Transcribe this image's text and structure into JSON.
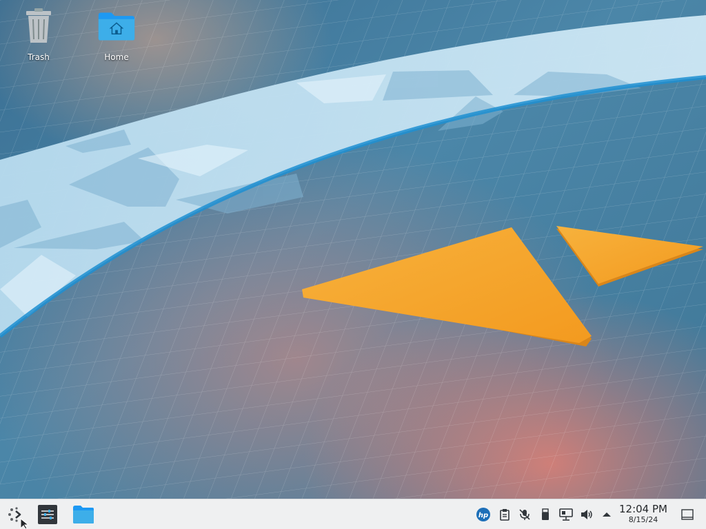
{
  "desktop": {
    "icons": [
      {
        "label": "Trash",
        "icon": "trash-icon"
      },
      {
        "label": "Home",
        "icon": "home-folder-icon"
      }
    ]
  },
  "panel": {
    "launcher_icon": "application-launcher-icon",
    "tasks": [
      {
        "icon": "system-settings-icon"
      },
      {
        "icon": "file-manager-icon"
      }
    ],
    "tray": [
      {
        "icon": "hp-device-manager-icon"
      },
      {
        "icon": "clipboard-icon"
      },
      {
        "icon": "microphone-muted-icon"
      },
      {
        "icon": "usb-device-icon"
      },
      {
        "icon": "network-wired-icon"
      },
      {
        "icon": "volume-icon"
      },
      {
        "icon": "expand-tray-arrow-icon"
      }
    ],
    "clock": {
      "time": "12:04 PM",
      "date": "8/15/24"
    },
    "show_desktop_icon": "show-desktop-icon"
  },
  "colors": {
    "panel_bg": "#eff0f1",
    "accent_blue": "#3daee9",
    "wallpaper_orange": "#f5a623"
  }
}
